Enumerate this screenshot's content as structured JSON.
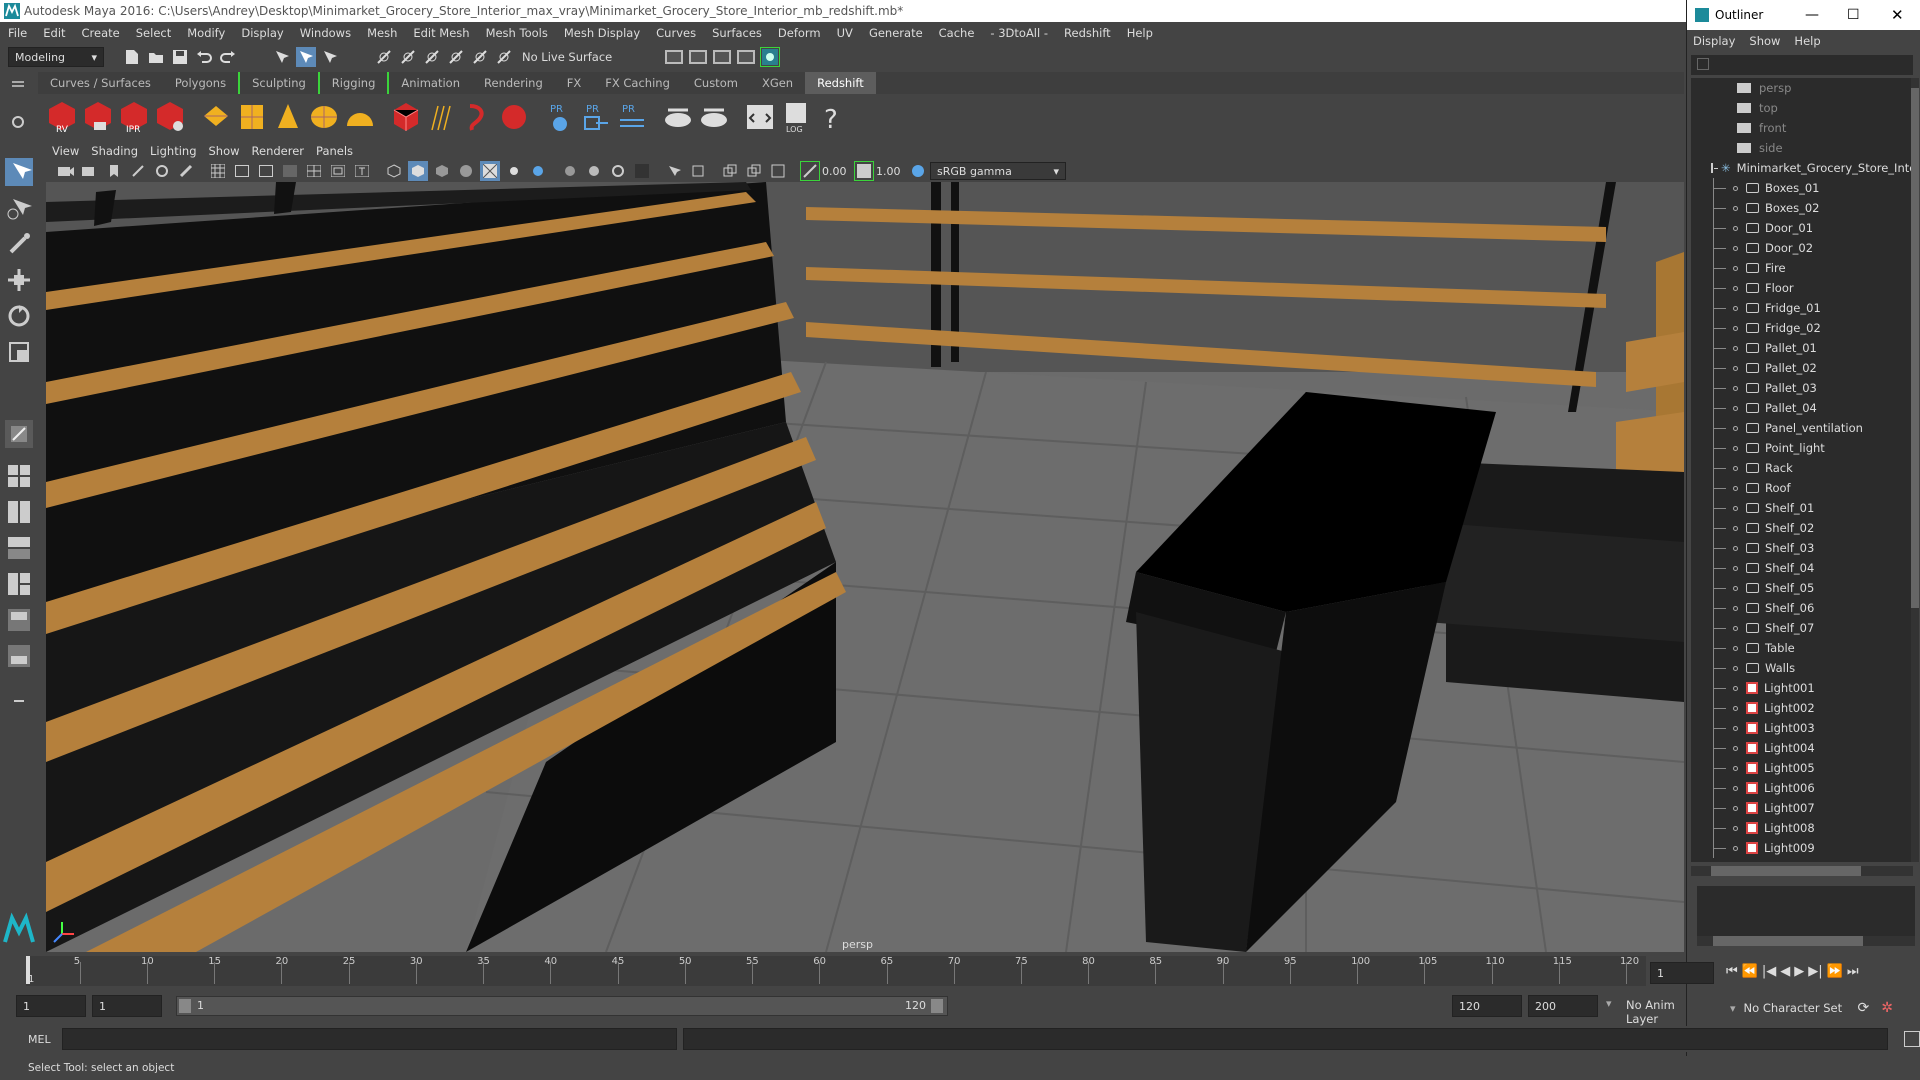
{
  "window": {
    "title": "Autodesk Maya 2016: C:\\Users\\Andrey\\Desktop\\Minimarket_Grocery_Store_Interior_max_vray\\Minimarket_Grocery_Store_Interior_mb_redshift.mb*"
  },
  "menubar": [
    "File",
    "Edit",
    "Create",
    "Select",
    "Modify",
    "Display",
    "Windows",
    "Mesh",
    "Edit Mesh",
    "Mesh Tools",
    "Mesh Display",
    "Curves",
    "Surfaces",
    "Deform",
    "UV",
    "Generate",
    "Cache",
    "- 3DtoAll -",
    "Redshift",
    "Help"
  ],
  "statusline": {
    "mode": "Modeling",
    "live_surface": "No Live Surface"
  },
  "shelf_tabs": [
    "Curves / Surfaces",
    "Polygons",
    "Sculpting",
    "Rigging",
    "Animation",
    "Rendering",
    "FX",
    "FX Caching",
    "Custom",
    "XGen",
    "Redshift"
  ],
  "shelf_active": "Redshift",
  "shelf_labels": {
    "rv": "RV",
    "ipr": "IPR",
    "pr": "PR",
    "log": "LOG",
    "help": "?"
  },
  "panel_menu": [
    "View",
    "Shading",
    "Lighting",
    "Show",
    "Renderer",
    "Panels"
  ],
  "panel_tools": {
    "exposure": "0.00",
    "gamma": "1.00",
    "colorspace": "sRGB gamma"
  },
  "viewport": {
    "camera_label": "persp"
  },
  "outliner": {
    "title": "Outliner",
    "menu": [
      "Display",
      "Show",
      "Help"
    ],
    "cameras": [
      "persp",
      "top",
      "front",
      "side"
    ],
    "root": "Minimarket_Grocery_Store_Interior",
    "children": [
      "Boxes_01",
      "Boxes_02",
      "Door_01",
      "Door_02",
      "Fire",
      "Floor",
      "Fridge_01",
      "Fridge_02",
      "Pallet_01",
      "Pallet_02",
      "Pallet_03",
      "Pallet_04",
      "Panel_ventilation",
      "Point_light",
      "Rack",
      "Roof",
      "Shelf_01",
      "Shelf_02",
      "Shelf_03",
      "Shelf_04",
      "Shelf_05",
      "Shelf_06",
      "Shelf_07",
      "Table",
      "Walls"
    ],
    "lights": [
      "Light001",
      "Light002",
      "Light003",
      "Light004",
      "Light005",
      "Light006",
      "Light007",
      "Light008",
      "Light009"
    ]
  },
  "timeline": {
    "ticks": [
      "5",
      "10",
      "15",
      "20",
      "25",
      "30",
      "35",
      "40",
      "45",
      "50",
      "55",
      "60",
      "65",
      "70",
      "75",
      "80",
      "85",
      "90",
      "95",
      "100",
      "105",
      "110",
      "115",
      "120"
    ],
    "start_tick": "1",
    "current_frame": "1"
  },
  "range": {
    "start": "1",
    "start2": "1",
    "slider_start": "1",
    "slider_end": "120",
    "end": "120",
    "end2": "200",
    "anim_layer": "No Anim Layer",
    "character_set": "No Character Set"
  },
  "mel": {
    "label": "MEL"
  },
  "help_line": "Select Tool: select an object",
  "colors": {
    "accent": "#5d5d5d",
    "wood": "#b5803c",
    "redshift_red": "#d42a2a",
    "shelf_yellow": "#f0b020",
    "bracket_green": "#3bd43b"
  }
}
